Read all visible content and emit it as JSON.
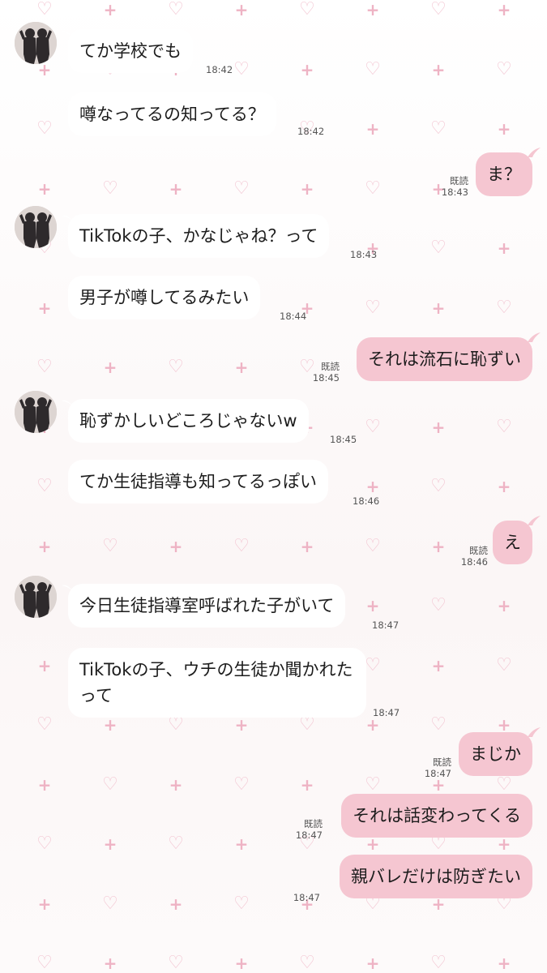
{
  "chat": {
    "colors": {
      "incoming_bubble": "#ffffff",
      "outgoing_bubble": "#f5c6d1",
      "pattern": "#f0bccb",
      "text": "#1c1c1c",
      "meta_text": "#555555"
    },
    "avatar_icon": "two-silhouettes-photo",
    "messages": [
      {
        "side": "in",
        "text": "てか学校でも",
        "time": "18:42"
      },
      {
        "side": "in",
        "text": "噂なってるの知ってる？",
        "time": "18:42"
      },
      {
        "side": "out",
        "text": "ま？",
        "read": "既読",
        "time": "18:43"
      },
      {
        "side": "in",
        "text": "TikTokの子、かなじゃね？って",
        "time": "18:43"
      },
      {
        "side": "in",
        "text": "男子が噂してるみたい",
        "time": "18:44"
      },
      {
        "side": "out",
        "text": "それは流石に恥ずい",
        "read": "既読",
        "time": "18:45"
      },
      {
        "side": "in",
        "text": "恥ずかしいどころじゃないw",
        "time": "18:45"
      },
      {
        "side": "in",
        "text": "てか生徒指導も知ってるっぽい",
        "time": "18:46"
      },
      {
        "side": "out",
        "text": "え",
        "read": "既読",
        "time": "18:46"
      },
      {
        "side": "in",
        "text": "今日生徒指導室呼ばれた子がいて",
        "time": "18:47"
      },
      {
        "side": "in",
        "text": "TikTokの子、ウチの生徒か聞かれたって",
        "time": "18:47"
      },
      {
        "side": "out",
        "text": "まじか",
        "read": "既読",
        "time": "18:47"
      },
      {
        "side": "out",
        "text": "それは話変わってくる",
        "read": "既読",
        "time": "18:47"
      },
      {
        "side": "out",
        "text": "親バレだけは防ぎたい",
        "time": "18:47"
      }
    ]
  }
}
